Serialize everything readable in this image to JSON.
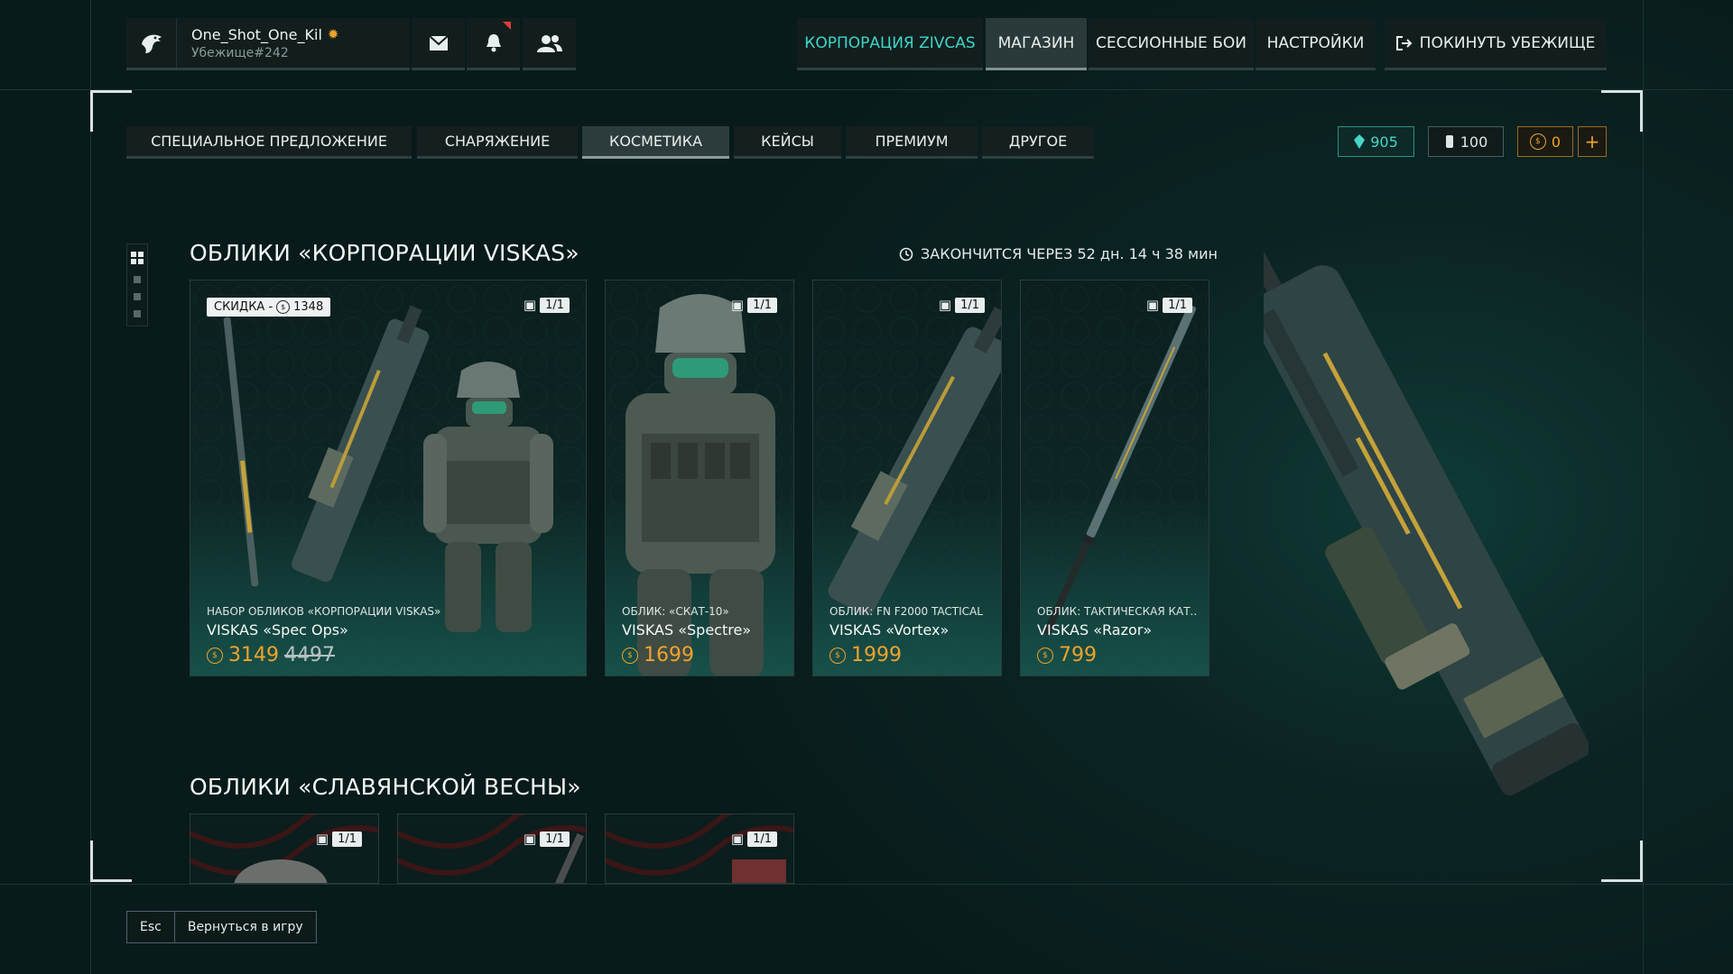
{
  "profile": {
    "username": "One_Shot_One_Kil",
    "shelter": "Убежище#242"
  },
  "nav": {
    "corp": "КОРПОРАЦИЯ ZIVCAS",
    "shop": "МАГАЗИН",
    "session": "СЕССИОННЫЕ БОИ",
    "settings": "НАСТРОЙКИ",
    "leave": "ПОКИНУТЬ УБЕЖИЩЕ"
  },
  "tabs": [
    "СПЕЦИАЛЬНОЕ ПРЕДЛОЖЕНИЕ",
    "СНАРЯЖЕНИЕ",
    "КОСМЕТИКА",
    "КЕЙСЫ",
    "ПРЕМИУМ",
    "ДРУГОЕ"
  ],
  "active_tab": "КОСМЕТИКА",
  "currency": {
    "crystals": "905",
    "tokens": "100",
    "coins": "0",
    "add": "+"
  },
  "section1": {
    "title": "ОБЛИКИ «КОРПОРАЦИИ VISKAS»",
    "timer": "ЗАКОНЧИТСЯ ЧЕРЕЗ 52 дн. 14 ч 38 мин",
    "cards": [
      {
        "discount_label": "СКИДКА -",
        "discount_value": "1348",
        "stock": "1/1",
        "subtitle": "НАБОР ОБЛИКОВ «КОРПОРАЦИИ VISKAS»",
        "name": "VISKAS «Spec Ops»",
        "price": "3149",
        "old_price": "4497"
      },
      {
        "stock": "1/1",
        "subtitle": "ОБЛИК: «СКАТ-10»",
        "name": "VISKAS «Spectre»",
        "price": "1699"
      },
      {
        "stock": "1/1",
        "subtitle": "ОБЛИК: FN F2000 TACTICAL",
        "name": "VISKAS «Vortex»",
        "price": "1999"
      },
      {
        "stock": "1/1",
        "subtitle": "ОБЛИК: ТАКТИЧЕСКАЯ КАТ..",
        "name": "VISKAS «Razor»",
        "price": "799"
      }
    ]
  },
  "section2": {
    "title": "ОБЛИКИ «СЛАВЯНСКОЙ ВЕСНЫ»",
    "cards": [
      {
        "stock": "1/1"
      },
      {
        "stock": "1/1"
      },
      {
        "stock": "1/1"
      }
    ]
  },
  "bottom": {
    "esc": "Esc",
    "return": "Вернуться в игру"
  },
  "colors": {
    "accent": "#3fd5c6",
    "price": "#f0a32b",
    "background": "#081a1a"
  }
}
